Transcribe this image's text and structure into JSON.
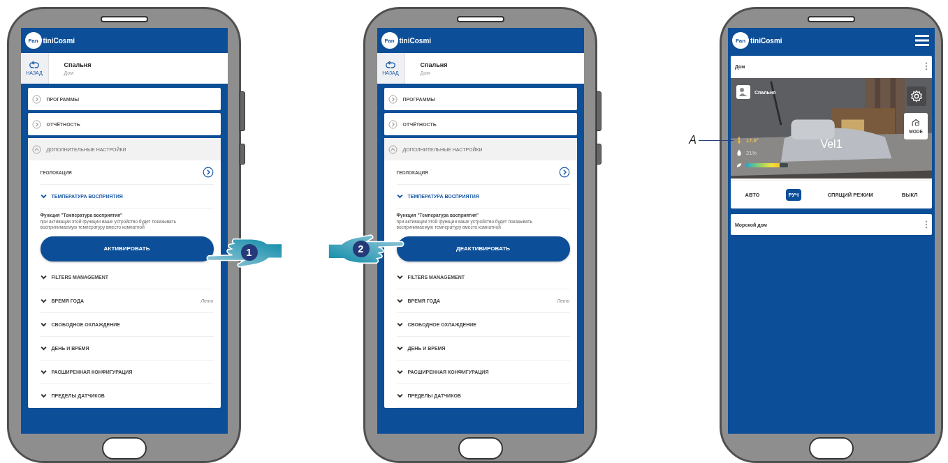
{
  "phones": [
    {
      "kind": "settings",
      "header": {
        "logo_badge": "Fan",
        "logo_text": "tiniCosmi"
      },
      "back": {
        "label": "НАЗАД"
      },
      "room": {
        "title": "Спальня",
        "subtitle": "Дом"
      },
      "sections": [
        {
          "label": "ПРОГРАММЫ",
          "expanded": false
        },
        {
          "label": "ОТЧЁТНОСТЬ",
          "expanded": false
        },
        {
          "label": "ДОПОЛНИТЕЛЬНЫЕ НАСТРОЙКИ",
          "expanded": true,
          "items": [
            {
              "kind": "link",
              "label": "ГЕОЛОКАЦИЯ"
            },
            {
              "kind": "option",
              "label": "ТЕМПЕРАТУРА ВОСПРИЯТИЯ",
              "expanded": true,
              "description": "**Функция \"Температура восприятия\"**\nпри активации этой функции ваше устройство будет показывать воспринимаемую температуру вместо комнатной",
              "button": "АКТИВИРОВАТЬ"
            },
            {
              "kind": "option",
              "label": "FILTERS MANAGEMENT",
              "expanded": false
            },
            {
              "kind": "option",
              "label": "ВРЕМЯ ГОДА",
              "expanded": false,
              "value": "Лето"
            },
            {
              "kind": "option",
              "label": "СВОБОДНОЕ ОХЛАЖДЕНИЕ",
              "expanded": false
            },
            {
              "kind": "option",
              "label": "ДЕНЬ И ВРЕМЯ",
              "expanded": false
            },
            {
              "kind": "option",
              "label": "РАСШИРЕННАЯ КОНФИГУРАЦИЯ",
              "expanded": false
            },
            {
              "kind": "option",
              "label": "ПРЕДЕЛЫ ДАТЧИКОВ",
              "expanded": false
            }
          ]
        }
      ],
      "gesture": {
        "step": "1",
        "kind": "right"
      }
    },
    {
      "kind": "settings",
      "header": {
        "logo_badge": "Fan",
        "logo_text": "tiniCosmi"
      },
      "back": {
        "label": "НАЗАД"
      },
      "room": {
        "title": "Спальня",
        "subtitle": "Дом"
      },
      "sections": [
        {
          "label": "ПРОГРАММЫ",
          "expanded": false
        },
        {
          "label": "ОТЧЁТНОСТЬ",
          "expanded": false
        },
        {
          "label": "ДОПОЛНИТЕЛЬНЫЕ НАСТРОЙКИ",
          "expanded": true,
          "items": [
            {
              "kind": "link",
              "label": "ГЕОЛОКАЦИЯ"
            },
            {
              "kind": "option",
              "label": "ТЕМПЕРАТУРА ВОСПРИЯТИЯ",
              "expanded": true,
              "description": "**Функция \"Температура восприятия\"**\nпри активации этой функции ваше устройство будет показывать воспринимаемую температуру вместо комнатной",
              "button": "ДЕАКТИВИРОВАТЬ"
            },
            {
              "kind": "option",
              "label": "FILTERS MANAGEMENT",
              "expanded": false
            },
            {
              "kind": "option",
              "label": "ВРЕМЯ ГОДА",
              "expanded": false,
              "value": "Лето"
            },
            {
              "kind": "option",
              "label": "СВОБОДНОЕ ОХЛАЖДЕНИЕ",
              "expanded": false
            },
            {
              "kind": "option",
              "label": "ДЕНЬ И ВРЕМЯ",
              "expanded": false
            },
            {
              "kind": "option",
              "label": "РАСШИРЕННАЯ КОНФИГУРАЦИЯ",
              "expanded": false
            },
            {
              "kind": "option",
              "label": "ПРЕДЕЛЫ ДАТЧИКОВ",
              "expanded": false
            }
          ]
        }
      ],
      "gesture": {
        "step": "2",
        "kind": "left"
      }
    },
    {
      "kind": "dashboard",
      "header": {
        "logo_badge": "Fan",
        "logo_text": "tiniCosmi"
      },
      "homes": [
        {
          "name": "Дом",
          "expanded": true,
          "rooms": [
            {
              "name": "Спальня",
              "temperature": "17.6°",
              "humidity": "21%",
              "fan": {
                "level": 0.8
              },
              "speed": "Vel1",
              "mode_button": "MODE",
              "callout": "A",
              "modes": [
                {
                  "label": "АВТО",
                  "selected": false
                },
                {
                  "label": "РУЧ",
                  "selected": true
                },
                {
                  "label": "СПЯЩИЙ РЕЖИМ",
                  "selected": false
                },
                {
                  "label": "ВЫКЛ",
                  "selected": false
                }
              ]
            }
          ]
        },
        {
          "name": "Морской дом"
        }
      ]
    }
  ]
}
